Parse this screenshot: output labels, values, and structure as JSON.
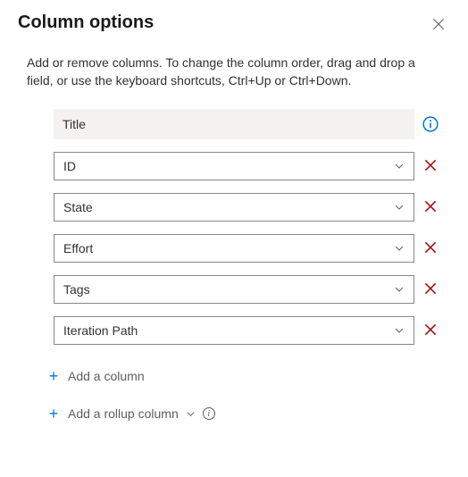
{
  "header": {
    "title": "Column options"
  },
  "description": "Add or remove columns. To change the column order, drag and drop a field, or use the keyboard shortcuts, Ctrl+Up or Ctrl+Down.",
  "locked_column": {
    "label": "Title"
  },
  "columns": [
    {
      "label": "ID"
    },
    {
      "label": "State"
    },
    {
      "label": "Effort"
    },
    {
      "label": "Tags"
    },
    {
      "label": "Iteration Path"
    }
  ],
  "actions": {
    "add_column": "Add a column",
    "add_rollup": "Add a rollup column"
  }
}
